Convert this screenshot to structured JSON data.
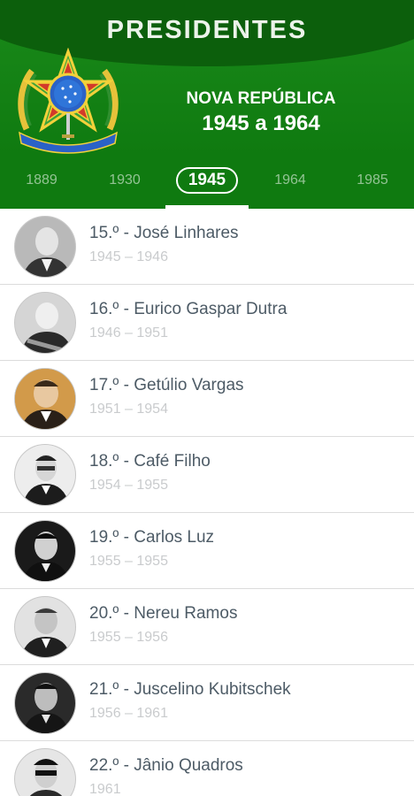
{
  "header": {
    "app_title": "PRESIDENTES",
    "era_name": "NOVA REPÚBLICA",
    "era_range": "1945 a 1964"
  },
  "tabs": [
    {
      "label": "1889",
      "active": false
    },
    {
      "label": "1930",
      "active": false
    },
    {
      "label": "1945",
      "active": true
    },
    {
      "label": "1964",
      "active": false
    },
    {
      "label": "1985",
      "active": false
    }
  ],
  "presidents": [
    {
      "title": "15.º - José Linhares",
      "years": "1945 – 1946"
    },
    {
      "title": "16.º - Eurico Gaspar Dutra",
      "years": "1946 – 1951"
    },
    {
      "title": "17.º - Getúlio Vargas",
      "years": "1951 – 1954"
    },
    {
      "title": "18.º - Café Filho",
      "years": "1954 – 1955"
    },
    {
      "title": "19.º - Carlos Luz",
      "years": "1955 – 1955"
    },
    {
      "title": "20.º - Nereu Ramos",
      "years": "1955 – 1956"
    },
    {
      "title": "21.º - Juscelino Kubitschek",
      "years": "1956 – 1961"
    },
    {
      "title": "22.º - Jânio Quadros",
      "years": "1961"
    }
  ],
  "colors": {
    "header_green": "#1a8a1a",
    "title_band_green": "#0c5f0c",
    "title_text": "#ecf3ea",
    "list_title": "#4d5b66",
    "list_subtitle": "#c9cbcd"
  },
  "icons": {
    "emblem": "brazil-coat-of-arms-icon"
  }
}
